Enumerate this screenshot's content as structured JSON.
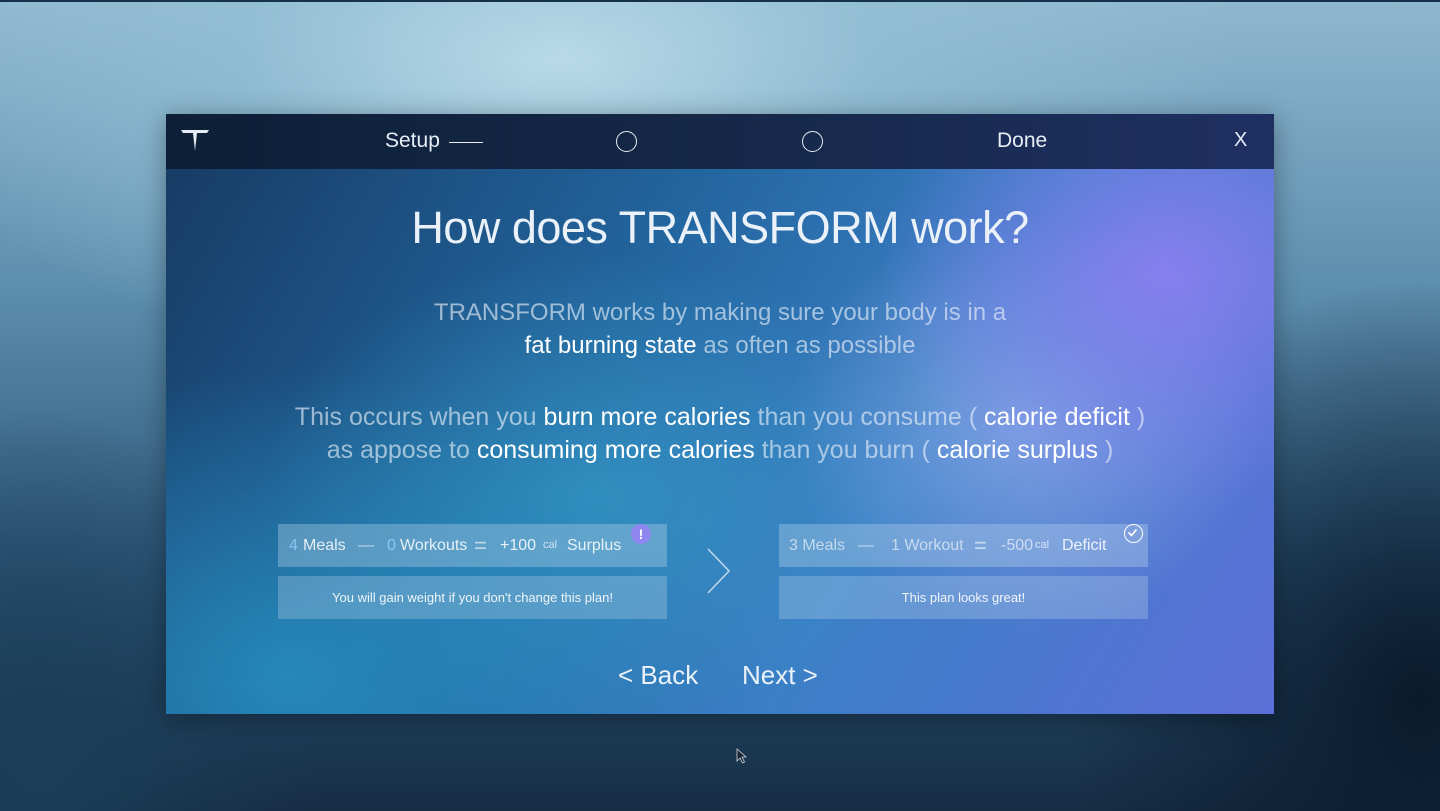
{
  "titlebar": {
    "logo_icon": "transform-logo-icon",
    "steps": {
      "setup_label": "Setup",
      "done_label": "Done"
    },
    "close_label": "X"
  },
  "main": {
    "heading": "How does TRANSFORM work?",
    "para1": {
      "line1": "TRANSFORM works by making sure your body is in a",
      "line2_bold": "fat burning state",
      "line2_rest": " as often as possible"
    },
    "para2": {
      "line1_a": "This occurs when you ",
      "line1_b": "burn more calories",
      "line1_c": " than you consume ( ",
      "line1_d": "calorie deficit",
      "line1_e": " )",
      "line2_a": "as appose to ",
      "line2_b": "consuming more calories",
      "line2_c": " than you burn ( ",
      "line2_d": "calorie surplus",
      "line2_e": " )"
    }
  },
  "plan_current": {
    "meals_count": "4",
    "meals_label": "Meals",
    "minus": "—",
    "workouts_count": "0",
    "workouts_label": "Workouts",
    "equals": "=",
    "calories": "+100",
    "cal_unit": "cal",
    "result_label": "Surplus",
    "alert": "!",
    "message": "You will gain weight if you don't change this plan!"
  },
  "plan_suggested": {
    "meals_text": "3 Meals",
    "minus": "—",
    "workouts_text": "1 Workout",
    "equals": "=",
    "calories": "-500",
    "cal_unit": "cal",
    "result_label": "Deficit",
    "message": "This plan looks great!"
  },
  "nav": {
    "back_label": "< Back",
    "next_label": "Next >"
  },
  "colors": {
    "accent_number": "#8fc4f5",
    "alert_badge": "#8f86f0"
  }
}
